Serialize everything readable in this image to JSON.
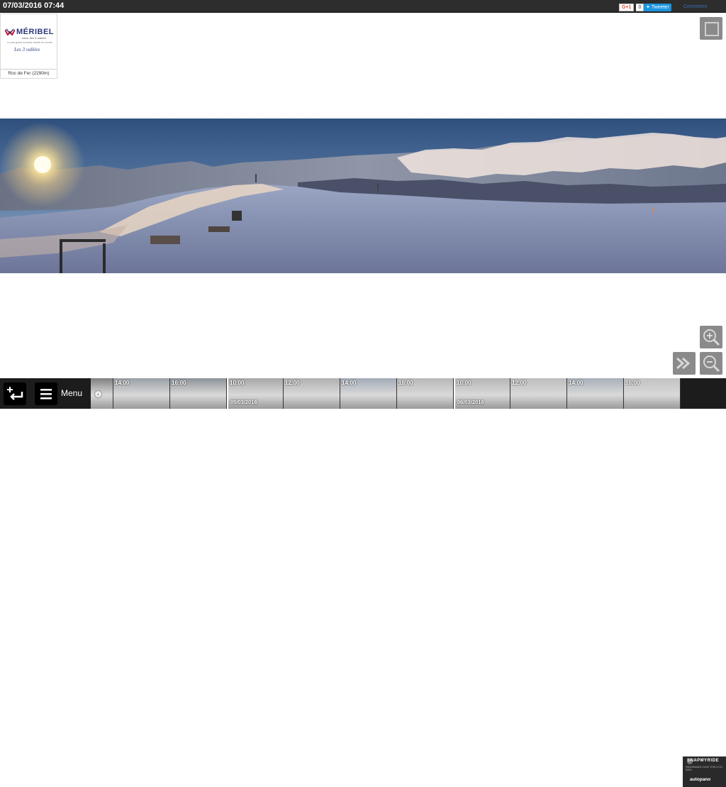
{
  "header": {
    "datetime": "07/03/2016 07:44",
    "gplus_label": "G+1",
    "gplus_count": "0",
    "tweet_label": "Tweeter",
    "login_label": "Connexion"
  },
  "logo": {
    "brand": "MÉRIBEL",
    "brand_sub": "cœur des 3 vallées",
    "tagline": "Le plus grand domaine skiable du monde",
    "vallees": "Les 3 vallées",
    "camera_name": "Roc de Fer (2290m)"
  },
  "bottom": {
    "menu_label": "Menu",
    "snap_title": "SNAPMYRIDE",
    "snap_sub": "PANORAMAS CLICK THIS & CO DATA",
    "snap_brand": "autopano"
  },
  "timeline": [
    {
      "time": "",
      "date": "",
      "daystart": false
    },
    {
      "time": "14:00",
      "date": "",
      "daystart": false
    },
    {
      "time": "16:00",
      "date": "",
      "daystart": false
    },
    {
      "time": "10:00",
      "date": "05/03/2016",
      "daystart": true
    },
    {
      "time": "12:00",
      "date": "",
      "daystart": false
    },
    {
      "time": "14:00",
      "date": "",
      "daystart": false
    },
    {
      "time": "16:00",
      "date": "",
      "daystart": false
    },
    {
      "time": "10:00",
      "date": "06/03/2016",
      "daystart": true
    },
    {
      "time": "12:00",
      "date": "",
      "daystart": false
    },
    {
      "time": "14:00",
      "date": "",
      "daystart": false
    },
    {
      "time": "16:00",
      "date": "",
      "daystart": false
    }
  ]
}
